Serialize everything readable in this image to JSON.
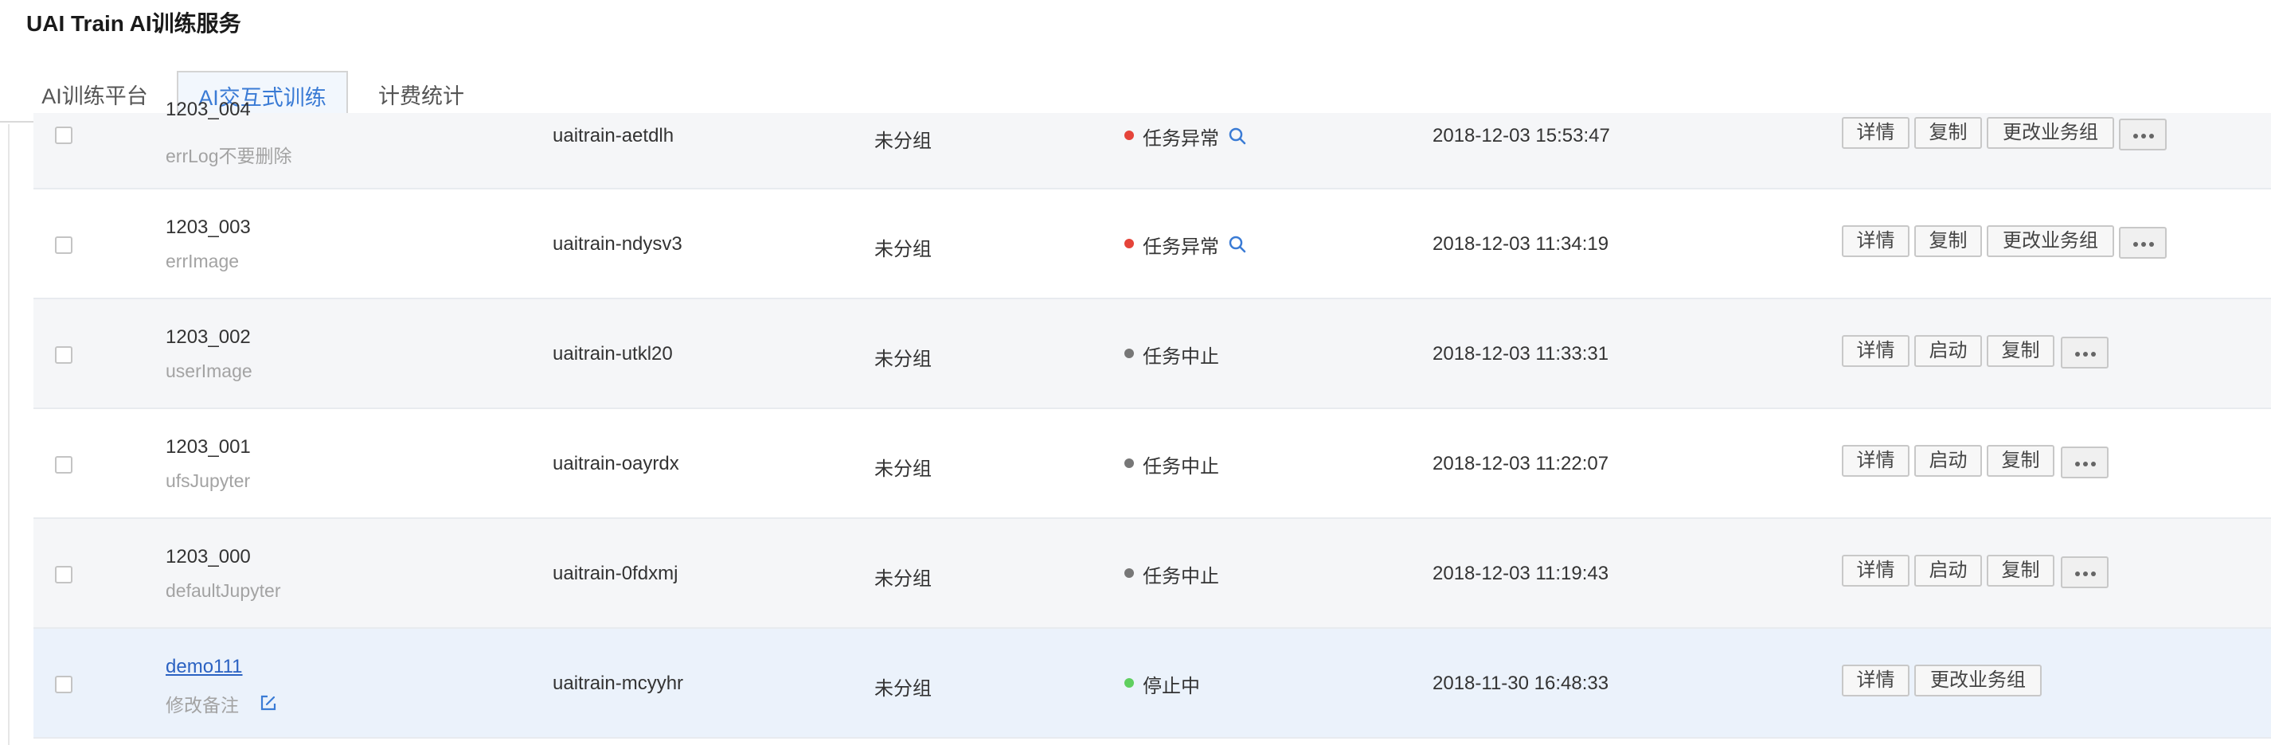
{
  "app": {
    "title": "UAI Train AI训练服务"
  },
  "tabs": [
    {
      "label": "AI训练平台"
    },
    {
      "label": "AI交互式训练"
    },
    {
      "label": "计费统计"
    }
  ],
  "colors": {
    "error": "#e5443a",
    "stopped_grey": "#777777",
    "running_green": "#5fcf5f",
    "accent": "#3a7bd5"
  },
  "rows": [
    {
      "name": "1203_004",
      "note": "errLog不要删除",
      "id": "uaitrain-aetdlh",
      "group": "未分组",
      "status": "任务异常",
      "time": "2018-12-03 15:53:47",
      "actions": [
        "详情",
        "复制",
        "更改业务组"
      ]
    },
    {
      "name": "1203_003",
      "note": "errImage",
      "id": "uaitrain-ndysv3",
      "group": "未分组",
      "status": "任务异常",
      "time": "2018-12-03 11:34:19",
      "actions": [
        "详情",
        "复制",
        "更改业务组"
      ]
    },
    {
      "name": "1203_002",
      "note": "userImage",
      "id": "uaitrain-utkl20",
      "group": "未分组",
      "status": "任务中止",
      "time": "2018-12-03 11:33:31",
      "actions": [
        "详情",
        "启动",
        "复制"
      ]
    },
    {
      "name": "1203_001",
      "note": "ufsJupyter",
      "id": "uaitrain-oayrdx",
      "group": "未分组",
      "status": "任务中止",
      "time": "2018-12-03 11:22:07",
      "actions": [
        "详情",
        "启动",
        "复制"
      ]
    },
    {
      "name": "1203_000",
      "note": "defaultJupyter",
      "id": "uaitrain-0fdxmj",
      "group": "未分组",
      "status": "任务中止",
      "time": "2018-12-03 11:19:43",
      "actions": [
        "详情",
        "启动",
        "复制"
      ]
    },
    {
      "name": "demo111",
      "note": "修改备注",
      "id": "uaitrain-mcyyhr",
      "group": "未分组",
      "status": "停止中",
      "time": "2018-11-30 16:48:33",
      "actions": [
        "详情",
        "更改业务组"
      ]
    }
  ]
}
